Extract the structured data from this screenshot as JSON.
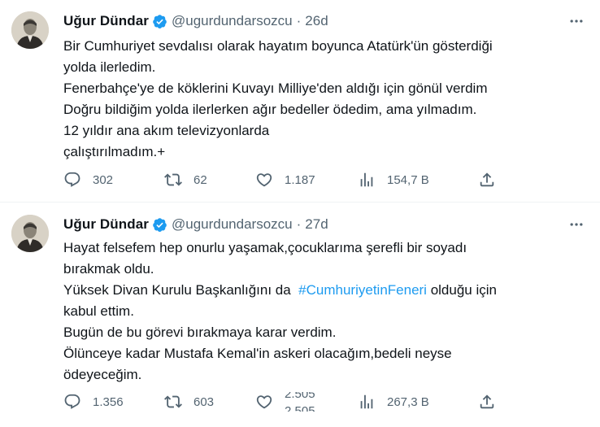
{
  "colors": {
    "text": "#0f1419",
    "muted": "#536471",
    "link": "#1d9bf0",
    "verified": "#1d9bf0",
    "divider": "#eff3f4"
  },
  "tweets": [
    {
      "author": {
        "name": "Uğur Dündar",
        "handle": "@ugurdundarsozcu",
        "verified": true
      },
      "time": "26d",
      "body_lines": [
        "Bir Cumhuriyet sevdalısı olarak hayatım boyunca Atatürk'ün gösterdiği",
        "yolda ilerledim.",
        "Fenerbahçe'ye de köklerini Kuvayı Milliye'den aldığı için gönül verdim",
        "Doğru bildiğim yolda ilerlerken ağır bedeller ödedim, ama yılmadım.",
        "12 yıldır ana akım televizyonlarda",
        "çalıştırılmadım.+"
      ],
      "stats": {
        "replies": "302",
        "retweets": "62",
        "likes": "1.187",
        "views": "154,7 B"
      }
    },
    {
      "author": {
        "name": "Uğur Dündar",
        "handle": "@ugurdundarsozcu",
        "verified": true
      },
      "time": "27d",
      "body": {
        "line1": "Hayat felsefem hep onurlu yaşamak,çocuklarıma şerefli bir soyadı",
        "line2": "bırakmak oldu.",
        "line3_before": "Yüksek Divan Kurulu Başkanlığını da",
        "hashtag": "#CumhuriyetinFeneri",
        "line3_after": "olduğu için",
        "line4": "kabul ettim.",
        "line5": "Bugün de bu görevi bırakmaya karar verdim.",
        "line6": "Ölünceye kadar Mustafa Kemal'in askeri olacağım,bedeli neyse",
        "line7": "ödeyeceğim."
      },
      "stats": {
        "replies": "1.356",
        "retweets": "603",
        "likes_old": "2.505",
        "likes_new": "2.505",
        "views": "267,3 B"
      }
    }
  ],
  "icons": [
    "avatar-portrait",
    "verified-badge-icon",
    "more-icon",
    "reply-icon",
    "retweet-icon",
    "like-icon",
    "views-icon",
    "share-icon"
  ]
}
